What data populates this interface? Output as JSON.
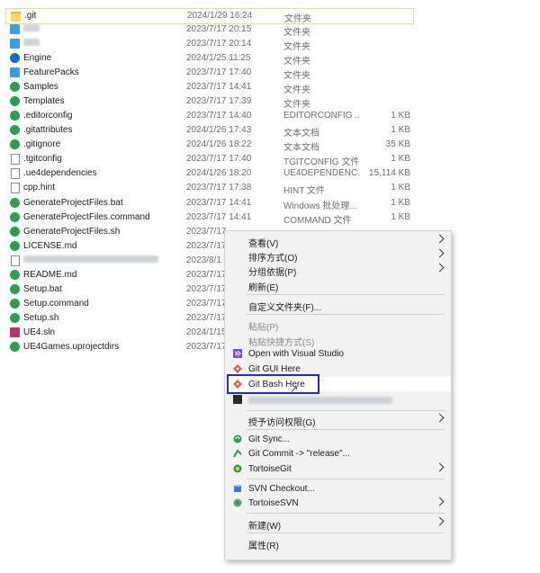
{
  "files": [
    {
      "name": ".git",
      "date": "2024/1/29 16:24",
      "type": "文件夹",
      "size": "",
      "icon": "folder-icon"
    },
    {
      "name": "",
      "date": "2023/7/17 20:15",
      "type": "文件夹",
      "size": "",
      "icon": "folder-icon"
    },
    {
      "name": "",
      "date": "2023/7/17 20:14",
      "type": "文件夹",
      "size": "",
      "icon": "folder-icon"
    },
    {
      "name": "Engine",
      "date": "2024/1/25 11:25",
      "type": "文件夹",
      "size": "",
      "icon": "engine-folder-icon"
    },
    {
      "name": "FeaturePacks",
      "date": "2023/7/17 17:40",
      "type": "文件夹",
      "size": "",
      "icon": "folder-icon"
    },
    {
      "name": "Samples",
      "date": "2023/7/17 14:41",
      "type": "文件夹",
      "size": "",
      "icon": "tortoise-folder-icon"
    },
    {
      "name": "Templates",
      "date": "2023/7/17 17:39",
      "type": "文件夹",
      "size": "",
      "icon": "tortoise-folder-icon"
    },
    {
      "name": ".editorconfig",
      "date": "2023/7/17 14:40",
      "type": "EDITORCONFIG ...",
      "size": "1 KB",
      "icon": "tortoise-file-icon"
    },
    {
      "name": ".gitattributes",
      "date": "2024/1/26 17:43",
      "type": "文本文档",
      "size": "1 KB",
      "icon": "tortoise-file-icon"
    },
    {
      "name": ".gitignore",
      "date": "2024/1/26 18:22",
      "type": "文本文档",
      "size": "35 KB",
      "icon": "tortoise-file-icon"
    },
    {
      "name": ".tgitconfig",
      "date": "2023/7/17 17:40",
      "type": "TGITCONFIG 文件",
      "size": "1 KB",
      "icon": "file-icon"
    },
    {
      "name": ".ue4dependencies",
      "date": "2024/1/26 18:20",
      "type": "UE4DEPENDENC...",
      "size": "15,114 KB",
      "icon": "file-icon"
    },
    {
      "name": "cpp.hint",
      "date": "2023/7/17 17:38",
      "type": "HINT 文件",
      "size": "1 KB",
      "icon": "file-icon"
    },
    {
      "name": "GenerateProjectFiles.bat",
      "date": "2023/7/17 14:41",
      "type": "Windows 批处理...",
      "size": "1 KB",
      "icon": "tortoise-file-icon"
    },
    {
      "name": "GenerateProjectFiles.command",
      "date": "2023/7/17 14:41",
      "type": "COMMAND 文件",
      "size": "1 KB",
      "icon": "tortoise-file-icon"
    },
    {
      "name": "GenerateProjectFiles.sh",
      "date": "2023/7/17",
      "type": "",
      "size": "",
      "icon": "tortoise-file-icon"
    },
    {
      "name": "LICENSE.md",
      "date": "2023/7/17",
      "type": "",
      "size": "",
      "icon": "tortoise-file-icon"
    },
    {
      "name": "",
      "date": "2023/8/1",
      "type": "",
      "size": "",
      "icon": "file-icon"
    },
    {
      "name": "README.md",
      "date": "2023/7/17",
      "type": "",
      "size": "",
      "icon": "tortoise-file-icon"
    },
    {
      "name": "Setup.bat",
      "date": "2023/7/17",
      "type": "",
      "size": "",
      "icon": "tortoise-file-icon"
    },
    {
      "name": "Setup.command",
      "date": "2023/7/17",
      "type": "",
      "size": "",
      "icon": "tortoise-file-icon"
    },
    {
      "name": "Setup.sh",
      "date": "2023/7/17",
      "type": "",
      "size": "",
      "icon": "tortoise-file-icon"
    },
    {
      "name": "UE4.sln",
      "date": "2024/1/15",
      "type": "",
      "size": "",
      "icon": "solution-file-icon"
    },
    {
      "name": "UE4Games.uprojectdirs",
      "date": "2023/7/17",
      "type": "",
      "size": "",
      "icon": "tortoise-file-icon"
    }
  ],
  "menu": {
    "view": "查看(V)",
    "sort": "排序方式(O)",
    "group": "分组依据(P)",
    "refresh": "刷新(E)",
    "customize": "自定义文件夹(F)...",
    "paste": "粘贴(P)",
    "paste_shortcut": "粘贴快捷方式(S)",
    "open_vs": "Open with Visual Studio",
    "git_gui": "Git GUI Here",
    "git_bash": "Git Bash Here",
    "grant_access": "授予访问权限(G)",
    "git_sync": "Git Sync...",
    "git_commit": "Git Commit -> \"release\"...",
    "tortoisegit": "TortoiseGit",
    "svn_checkout": "SVN Checkout...",
    "tortoisesvn": "TortoiseSVN",
    "new": "新建(W)",
    "properties": "属性(R)"
  },
  "colors": {
    "highlight_border": "#1e2fd0",
    "menu_bg": "#f2f2f2",
    "folder": "#ffd36e",
    "tortoise_green": "#2e9c52"
  }
}
